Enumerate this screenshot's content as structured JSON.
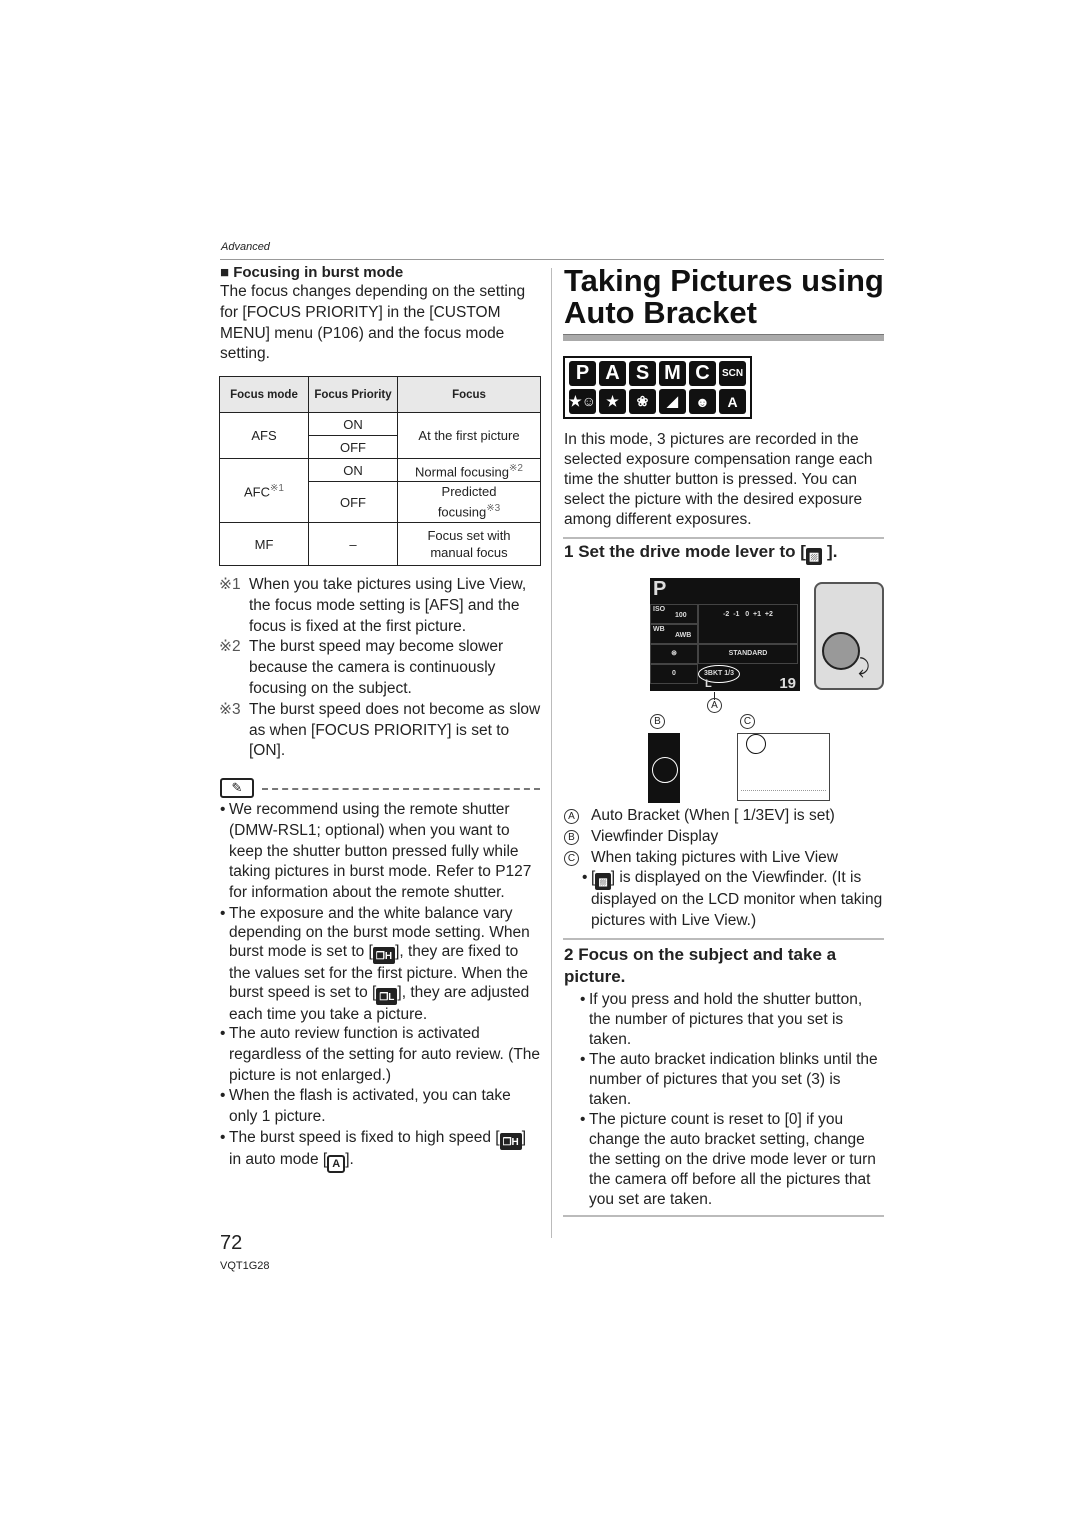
{
  "header": {
    "section": "Advanced"
  },
  "left": {
    "heading": "Focusing in burst mode",
    "intro": "The focus changes depending on the setting for [FOCUS PRIORITY] in the [CUSTOM MENU] menu (P106) and the focus mode setting.",
    "table": {
      "headers": [
        "Focus mode",
        "Focus Priority",
        "Focus"
      ],
      "rows": [
        {
          "mode": "AFS",
          "priority": [
            "ON",
            "OFF"
          ],
          "focus": "At the first picture"
        },
        {
          "mode": "AFC",
          "mode_note": "※1",
          "priority": [
            "ON",
            "OFF"
          ],
          "focus": [
            "Normal focusing",
            "Predicted focusing"
          ],
          "focus_notes": [
            "※2",
            "※3"
          ]
        },
        {
          "mode": "MF",
          "priority": "–",
          "focus": "Focus set with manual focus"
        }
      ]
    },
    "footnotes": [
      {
        "mark": "※1",
        "text": "When you take pictures using Live View, the focus mode setting is [AFS] and the focus is fixed at the first picture."
      },
      {
        "mark": "※2",
        "text": "The burst speed may become slower because the camera is continuously focusing on the subject."
      },
      {
        "mark": "※3",
        "text": "The burst speed does not become as slow as when [FOCUS PRIORITY] is set to [ON]."
      }
    ],
    "notes": {
      "b1": "We recommend using the remote shutter (DMW-RSL1; optional) when you want to keep the shutter button pressed fully while taking pictures in burst mode. Refer to P127 for information about the remote shutter.",
      "b2a": "The exposure and the white balance vary depending on the burst mode setting. When burst mode is set to [",
      "b2b": "], they are fixed to the values set for the first picture. When the burst speed is set to [",
      "b2c": "], they are adjusted each time you take a picture.",
      "b3": "The auto review function is activated regardless of the setting for auto review. (The picture is not enlarged.)",
      "b4": "When the flash is activated, you can take only 1 picture.",
      "b5a": "The burst speed is fixed to high speed [",
      "b5b": "] in auto mode [",
      "b5c": "].",
      "icon_h": "❒H",
      "icon_l": "❒L",
      "icon_auto": "A"
    }
  },
  "footer": {
    "page": "72",
    "code": "VQT1G28"
  },
  "right": {
    "title_line1": "Taking Pictures using",
    "title_line2": "Auto Bracket",
    "modes": [
      "P",
      "A",
      "S",
      "M",
      "C",
      "SCN",
      "★☺",
      "★",
      "❀",
      "◢",
      "☻",
      "A"
    ],
    "intro": "In this mode, 3 pictures are recorded in the selected exposure compensation range each time the shutter button is pressed. You can select the picture with the desired exposure among different exposures.",
    "step1_num": "1",
    "step1": "Set the drive mode lever to [",
    "step1_end": "].",
    "lcd": {
      "mode": "P",
      "iso_label": "ISO",
      "iso": "100",
      "wb_label": "WB",
      "wb": "AWB",
      "scale": "-2  -1   0  +1  +2",
      "style": "STANDARD",
      "flash_comp": "0",
      "bkt": "3BKT 1/3",
      "count": "19",
      "size": "L"
    },
    "figure_labels": {
      "a": "A",
      "b": "B",
      "c": "C"
    },
    "legend": [
      {
        "letter": "A",
        "text": "Auto Bracket (When [  1/3EV] is set)"
      },
      {
        "letter": "B",
        "text": "Viewfinder Display"
      },
      {
        "letter": "C",
        "text": "When taking pictures with Live View"
      }
    ],
    "legend_bullet_a": "[",
    "legend_bullet_b": "] is displayed on the Viewfinder. (It is displayed on the LCD monitor when taking pictures with Live View.)",
    "step2_num": "2",
    "step2": "Focus on the subject and take a picture.",
    "bullets": [
      "If you press and hold the shutter button, the number of pictures that you set is taken.",
      "The auto bracket indication blinks until the number of pictures that you set (3) is taken.",
      "The picture count is reset to [0] if you change the auto bracket setting, change the setting on the drive mode lever or turn the camera off before all the pictures that you set are taken."
    ]
  }
}
